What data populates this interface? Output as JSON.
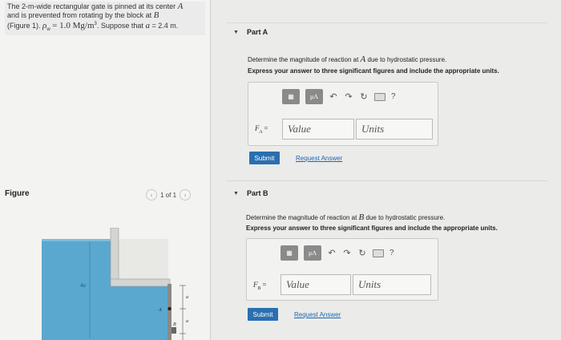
{
  "problem": {
    "line1": "The 2-m-wide rectangular gate is pinned at its center",
    "line1_var": "A",
    "line2": "and is prevented from rotating by the block at",
    "line2_var": "B",
    "line3_a": "(Figure 1).",
    "line3_rho": "ρ",
    "line3_rho_sub": "w",
    "line3_b": "= 1.0 Mg/m",
    "line3_exp": "3",
    "line3_c": ". Suppose that",
    "line3_var": "a",
    "line3_d": "= 2.4 m."
  },
  "figure": {
    "label": "Figure",
    "page_indicator": "1 of 1",
    "labels": {
      "depth": "4a",
      "pin": "A",
      "block": "B",
      "dim_top": "a",
      "dim_bottom": "a"
    },
    "colors": {
      "water": "#5aa8cf",
      "water_dark": "#3f8fb8",
      "wall": "#d8d8d4",
      "gate": "#8a8a84"
    }
  },
  "partA": {
    "title": "Part A",
    "question": "Determine the magnitude of reaction at",
    "question_var": "A",
    "question_tail": "due to hydrostatic pressure.",
    "instruction": "Express your answer to three significant figures and include the appropriate units.",
    "var_label": "F",
    "var_sub": "A",
    "equals": "=",
    "value_placeholder": "Value",
    "units_placeholder": "Units",
    "submit": "Submit",
    "request": "Request Answer"
  },
  "partB": {
    "title": "Part B",
    "question": "Determine the magnitude of reaction at",
    "question_var": "B",
    "question_tail": "due to hydrostatic pressure.",
    "instruction": "Express your answer to three significant figures and include the appropriate units.",
    "var_label": "F",
    "var_sub": "B",
    "equals": "=",
    "value_placeholder": "Value",
    "units_placeholder": "Units",
    "submit": "Submit",
    "request": "Request Answer"
  },
  "toolbar": {
    "mu_label": "μA",
    "help": "?"
  },
  "colors": {
    "accent": "#2a6fb0",
    "link": "#1e66b0"
  }
}
